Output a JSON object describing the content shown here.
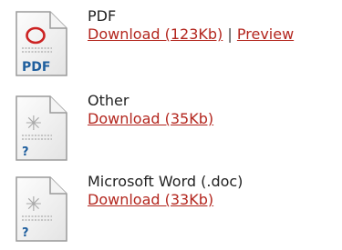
{
  "files": [
    {
      "type": "PDF",
      "icon": "pdf-file-icon",
      "icon_badge": "PDF",
      "download_label": "Download (123Kb)",
      "separator": "|",
      "preview_label": "Preview"
    },
    {
      "type": "Other",
      "icon": "generic-file-icon",
      "icon_badge": "?",
      "download_label": "Download (35Kb)"
    },
    {
      "type": "Microsoft Word (.doc)",
      "icon": "generic-file-icon",
      "icon_badge": "?",
      "download_label": "Download (33Kb)"
    }
  ],
  "colors": {
    "link": "#b3261e",
    "pdf_ring": "#cc2222",
    "pdf_badge": "#1f5f9e",
    "unknown_badge": "#1f5f9e"
  }
}
